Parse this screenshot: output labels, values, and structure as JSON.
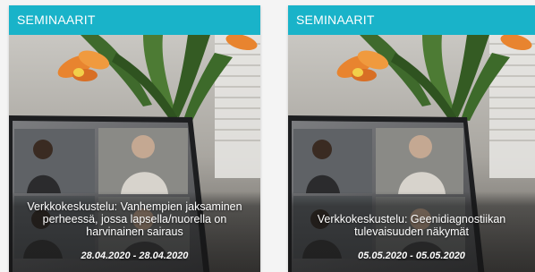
{
  "cards": [
    {
      "category": "SEMINAARIT",
      "title": "Verkkokeskustelu: Vanhempien jaksaminen perheessä, jossa lapsella/nuorella on harvinainen sairaus",
      "date": "28.04.2020 - 28.04.2020"
    },
    {
      "category": "SEMINAARIT",
      "title": "Verkkokeskustelu: Geenidiagnostiikan tulevaisuuden näkymät",
      "date": "05.05.2020 - 05.05.2020"
    }
  ],
  "colors": {
    "header": "#19b3c9",
    "text": "#ffffff"
  }
}
